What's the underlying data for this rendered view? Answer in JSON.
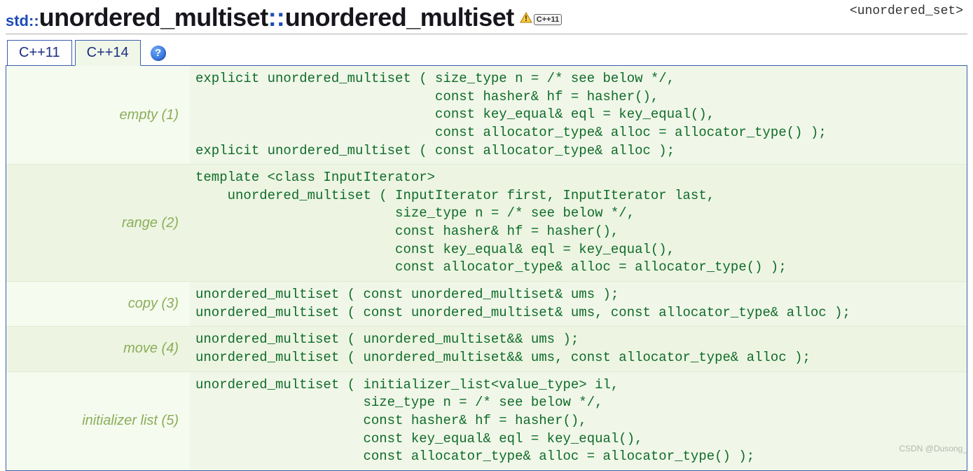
{
  "title": {
    "prefix": "std::",
    "class": "unordered_multiset",
    "sep": "::",
    "member": "unordered_multiset",
    "cpp_badge": "C++11"
  },
  "header_include": "<unordered_set>",
  "tabs": [
    {
      "label": "C++11",
      "active": false
    },
    {
      "label": "C++14",
      "active": true
    }
  ],
  "help_icon": "?",
  "declarations": [
    {
      "label": "empty (1)",
      "code": "explicit unordered_multiset ( size_type n = /* see below */,\n                              const hasher& hf = hasher(),\n                              const key_equal& eql = key_equal(),\n                              const allocator_type& alloc = allocator_type() );\nexplicit unordered_multiset ( const allocator_type& alloc );"
    },
    {
      "label": "range (2)",
      "code": "template <class InputIterator>\n    unordered_multiset ( InputIterator first, InputIterator last,\n                         size_type n = /* see below */,\n                         const hasher& hf = hasher(),\n                         const key_equal& eql = key_equal(),\n                         const allocator_type& alloc = allocator_type() );"
    },
    {
      "label": "copy (3)",
      "code": "unordered_multiset ( const unordered_multiset& ums );\nunordered_multiset ( const unordered_multiset& ums, const allocator_type& alloc );"
    },
    {
      "label": "move (4)",
      "code": "unordered_multiset ( unordered_multiset&& ums );\nunordered_multiset ( unordered_multiset&& ums, const allocator_type& alloc );"
    },
    {
      "label": "initializer list (5)",
      "code": "unordered_multiset ( initializer_list<value_type> il,\n                     size_type n = /* see below */,\n                     const hasher& hf = hasher(),\n                     const key_equal& eql = key_equal(),\n                     const allocator_type& alloc = allocator_type() );"
    }
  ],
  "watermark": "CSDN @Dusong_"
}
